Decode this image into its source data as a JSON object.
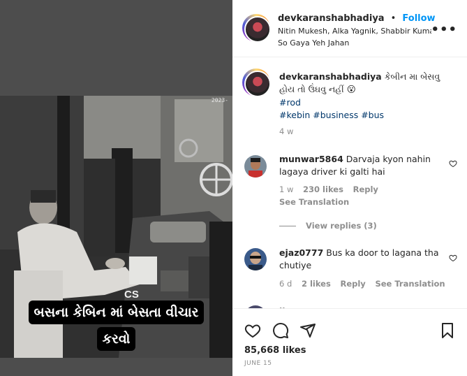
{
  "video": {
    "timestamp": "2023-",
    "cs_text": "CS",
    "caption_line1": "બસના કેબિન માં બેસતા વીચાર",
    "caption_line2": "કરવો"
  },
  "header": {
    "username": "devkaranshabhadiya",
    "separator": "•",
    "follow_label": "Follow",
    "audio_line": "Nitin Mukesh, Alka Yagnik, Shabbir Kumar",
    "song_line": "So Gaya Yeh Jahan",
    "more_label": "•••"
  },
  "post": {
    "username": "devkaranshabhadiya",
    "caption": "કેબીન મા બેસવુ હોય તો ઉંઘવુ નહીં",
    "emoji": "😮",
    "tags_line1": "#rod",
    "tags_line2": "#kebin #business #bus",
    "age": "4 w"
  },
  "comments": [
    {
      "username": "munwar5864",
      "text": "Darvaja kyon nahin lagaya driver ki galti hai",
      "age": "1 w",
      "likes": "230 likes",
      "reply": "Reply",
      "translation": "See Translation",
      "view_replies": "View replies (3)"
    },
    {
      "username": "ejaz0777",
      "text": "Bus ka door to lagana tha chutiye",
      "age": "6 d",
      "likes": "2 likes",
      "reply": "Reply",
      "translation": "See Translation"
    },
    {
      "username": "ll",
      "text": "..."
    }
  ],
  "actions": {
    "likes_count": "85,668 likes",
    "date": "JUNE 15"
  },
  "colors": {
    "accent": "#0095f6",
    "muted": "#8e8e8e",
    "text": "#262626"
  }
}
